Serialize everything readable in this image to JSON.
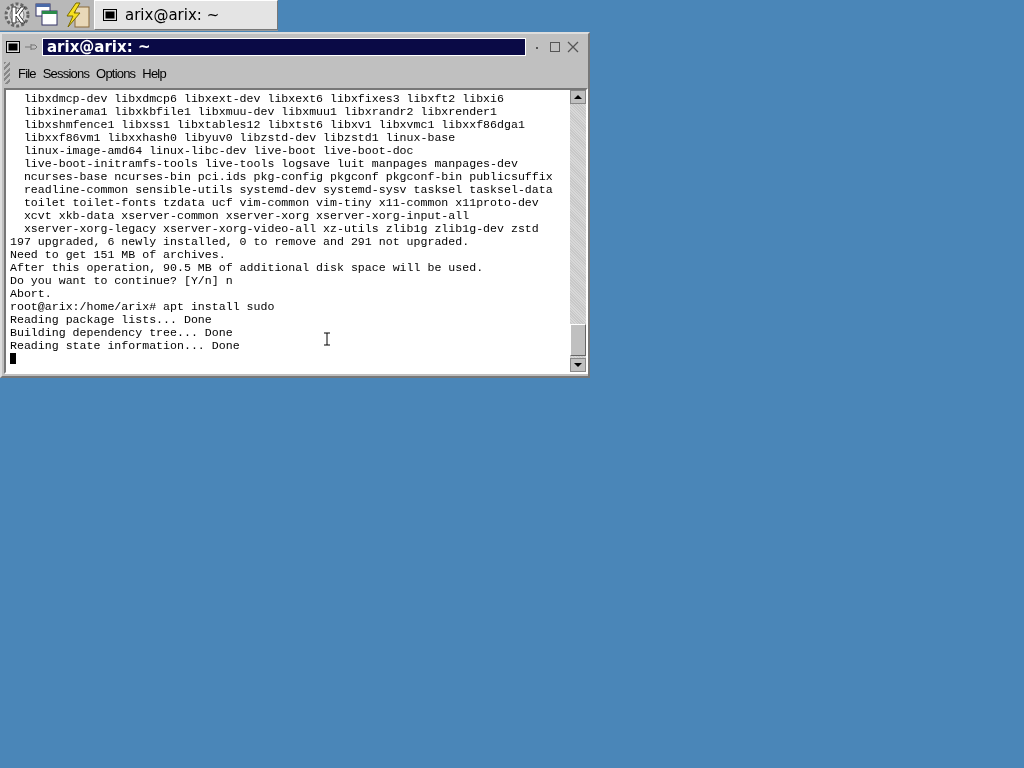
{
  "taskbar": {
    "tasks": [
      {
        "title": "arix@arix: ~",
        "selected": true
      }
    ]
  },
  "window": {
    "title": "arix@arix: ~"
  },
  "menu": [
    "File",
    "Sessions",
    "Options",
    "Help"
  ],
  "terminal": {
    "lines": [
      "  libxdmcp-dev libxdmcp6 libxext-dev libxext6 libxfixes3 libxft2 libxi6",
      "  libxinerama1 libxkbfile1 libxmuu-dev libxmuu1 libxrandr2 libxrender1",
      "  libxshmfence1 libxss1 libxtables12 libxtst6 libxv1 libxvmc1 libxxf86dga1",
      "  libxxf86vm1 libxxhash0 libyuv0 libzstd-dev libzstd1 linux-base",
      "  linux-image-amd64 linux-libc-dev live-boot live-boot-doc",
      "  live-boot-initramfs-tools live-tools logsave luit manpages manpages-dev",
      "  ncurses-base ncurses-bin pci.ids pkg-config pkgconf pkgconf-bin publicsuffix",
      "  readline-common sensible-utils systemd-dev systemd-sysv tasksel tasksel-data",
      "  toilet toilet-fonts tzdata ucf vim-common vim-tiny x11-common x11proto-dev",
      "  xcvt xkb-data xserver-common xserver-xorg xserver-xorg-input-all",
      "  xserver-xorg-legacy xserver-xorg-video-all xz-utils zlib1g zlib1g-dev zstd",
      "197 upgraded, 6 newly installed, 0 to remove and 291 not upgraded.",
      "Need to get 151 MB of archives.",
      "After this operation, 90.5 MB of additional disk space will be used.",
      "Do you want to continue? [Y/n] n",
      "Abort.",
      "root@arix:/home/arix# apt install sudo",
      "Reading package lists... Done",
      "Building dependency tree... Done",
      "Reading state information... Done"
    ],
    "cursor": true
  }
}
